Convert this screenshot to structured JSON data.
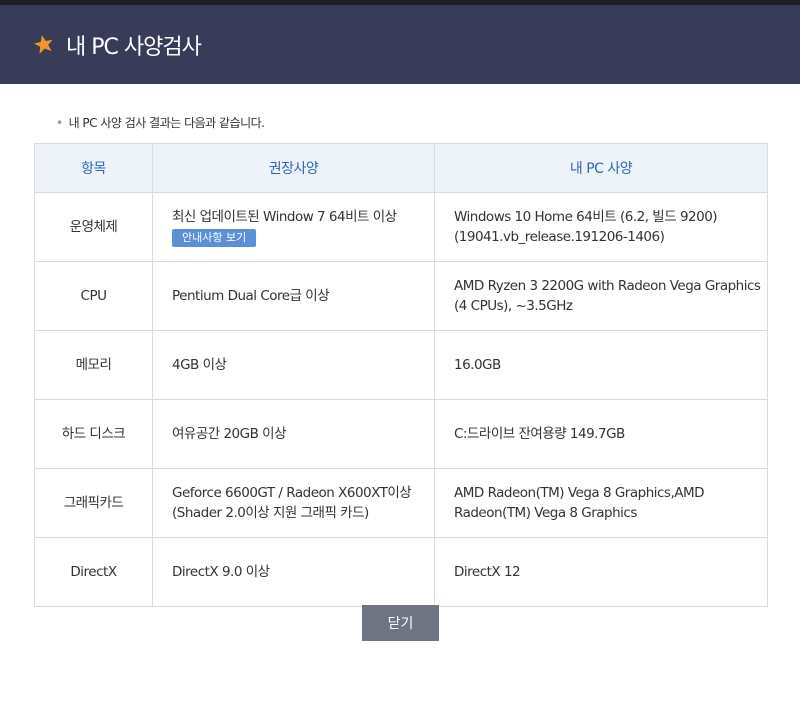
{
  "header": {
    "title": "내 PC 사양검사",
    "icon": "star-icon"
  },
  "intro": "내 PC 사양 검사 결과는 다음과 같습니다.",
  "table": {
    "headers": [
      "항목",
      "권장사양",
      "내 PC 사양"
    ],
    "rows": [
      {
        "label": "운영체제",
        "recommended": "최신 업데이트된 Window 7 64비트 이상",
        "guide_button": "안내사항 보기",
        "mine": [
          "Windows 10 Home 64비트 (6.2, 빌드 9200)",
          "(19041.vb_release.191206-1406)"
        ]
      },
      {
        "label": "CPU",
        "recommended": "Pentium Dual Core급 이상",
        "mine": [
          "AMD Ryzen 3 2200G with Radeon Vega Graphics",
          "(4 CPUs), ~3.5GHz"
        ]
      },
      {
        "label": "메모리",
        "recommended": "4GB 이상",
        "mine": [
          "16.0GB"
        ]
      },
      {
        "label": "하드 디스크",
        "recommended": "여유공간 20GB 이상",
        "mine": [
          "C:드라이브 잔여용량 149.7GB"
        ]
      },
      {
        "label": "그래픽카드",
        "recommended": [
          "Geforce 6600GT / Radeon X600XT이상",
          "(Shader 2.0이상 지원 그래픽 카드)"
        ],
        "mine": [
          "AMD Radeon(TM) Vega 8 Graphics,AMD",
          "Radeon(TM) Vega 8 Graphics"
        ]
      },
      {
        "label": "DirectX",
        "recommended": "DirectX 9.0 이상",
        "mine": [
          "DirectX 12"
        ]
      }
    ]
  },
  "close_button": "닫기",
  "colors": {
    "header_bg": "#393c58",
    "header_accent": "#f0962a",
    "th_text": "#2f67b4",
    "th_bg": "#eef3fa",
    "guide_btn": "#5d8fd8",
    "close_btn": "#6f7482"
  }
}
